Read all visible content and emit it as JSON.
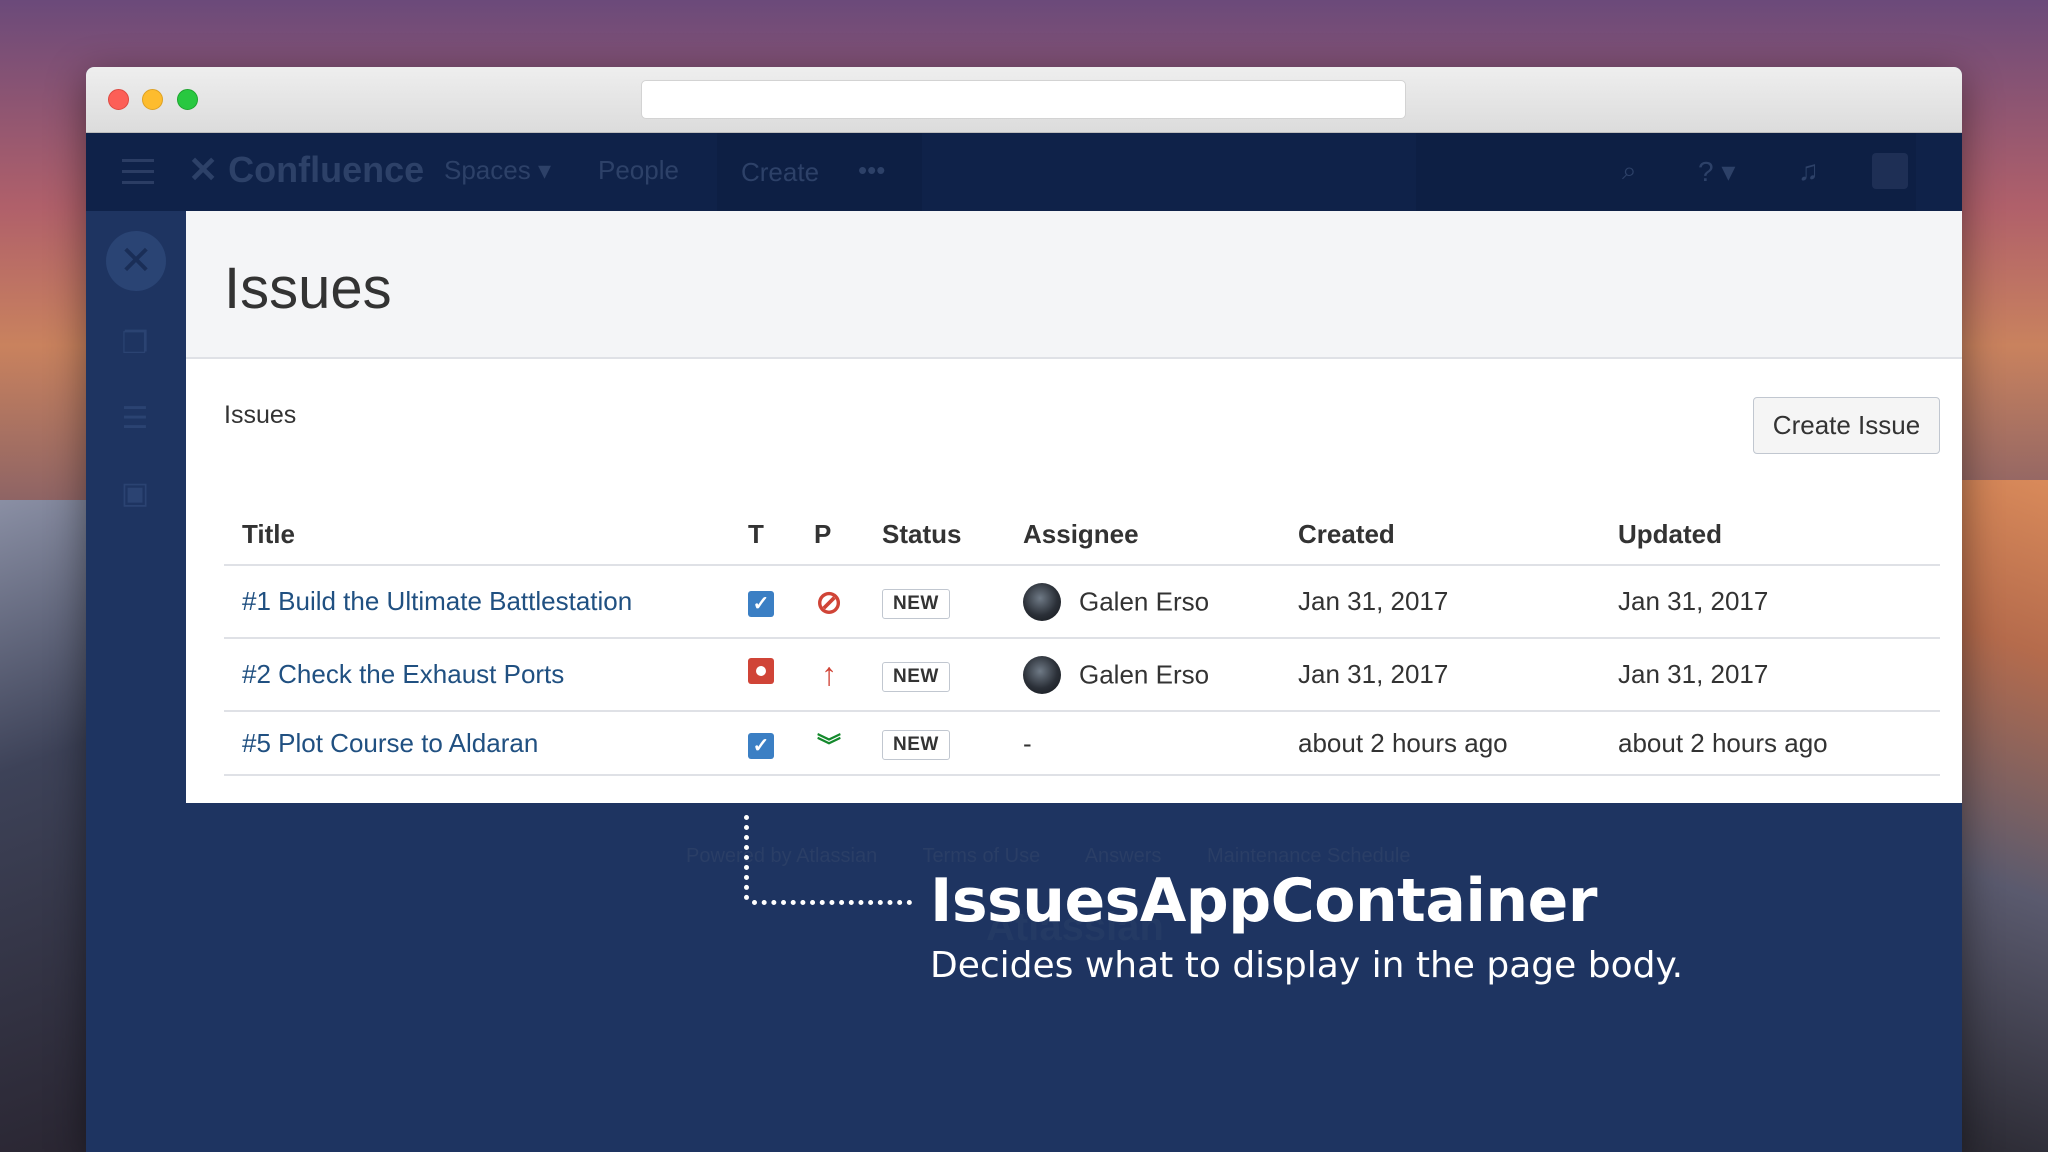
{
  "topnav": {
    "logo": "Confluence",
    "spaces": "Spaces",
    "people": "People",
    "create": "Create",
    "more": "•••",
    "search_icon": "search-icon",
    "help_icon": "help-icon",
    "bell_icon": "bell-icon"
  },
  "page": {
    "title": "Issues",
    "section_label": "Issues",
    "create_button": "Create Issue"
  },
  "table": {
    "headers": {
      "title": "Title",
      "t": "T",
      "p": "P",
      "status": "Status",
      "assignee": "Assignee",
      "created": "Created",
      "updated": "Updated"
    },
    "rows": [
      {
        "title": "#1 Build the Ultimate Battlestation",
        "type": "task",
        "priority": "blocker",
        "status": "NEW",
        "assignee": "Galen Erso",
        "created": "Jan 31, 2017",
        "updated": "Jan 31, 2017"
      },
      {
        "title": "#2 Check the Exhaust Ports",
        "type": "bug",
        "priority": "major",
        "status": "NEW",
        "assignee": "Galen Erso",
        "created": "Jan 31, 2017",
        "updated": "Jan 31, 2017"
      },
      {
        "title": "#5 Plot Course to Aldaran",
        "type": "task",
        "priority": "minor",
        "status": "NEW",
        "assignee": "-",
        "created": "about 2 hours ago",
        "updated": "about 2 hours ago"
      }
    ]
  },
  "footer": {
    "powered": "Powered by Atlassian",
    "terms": "Terms of Use",
    "answers": "Answers",
    "maintenance": "Maintenance Schedule",
    "logo": "Atlassian"
  },
  "annotation": {
    "title": "IssuesAppContainer",
    "subtitle": "Decides what to display in the page body."
  },
  "colors": {
    "nav_bg": "#0f2249",
    "link": "#205081",
    "task": "#3b7fc4",
    "bug": "#d04437",
    "minor": "#14892c"
  }
}
